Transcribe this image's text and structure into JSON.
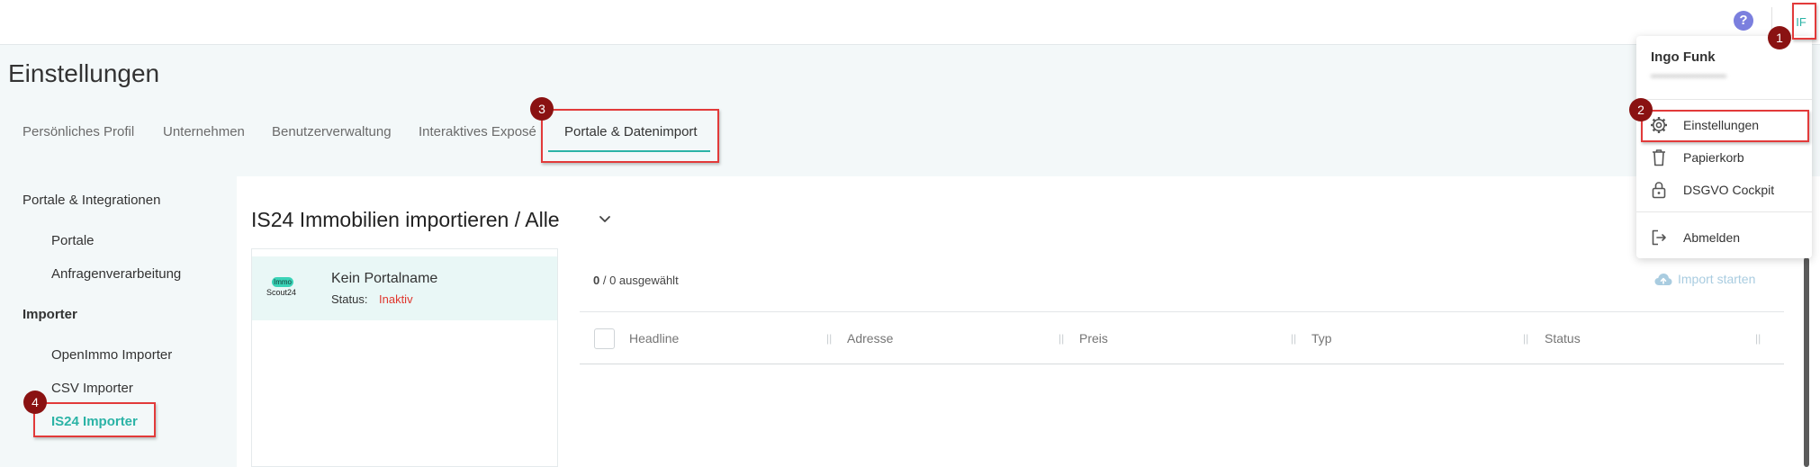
{
  "topbar": {
    "help_icon": "question-circle-icon",
    "avatar_initials": "IF"
  },
  "page": {
    "title": "Einstellungen"
  },
  "tabs": [
    {
      "label": "Persönliches Profil"
    },
    {
      "label": "Unternehmen"
    },
    {
      "label": "Benutzerverwaltung"
    },
    {
      "label": "Interaktives Exposé"
    },
    {
      "label": "Portale & Datenimport",
      "active": true
    }
  ],
  "sidebar": {
    "section1": {
      "heading": "Portale & Integrationen",
      "items": [
        {
          "label": "Portale"
        },
        {
          "label": "Anfragenverarbeitung"
        }
      ]
    },
    "section2": {
      "heading": "Importer",
      "items": [
        {
          "label": "OpenImmo Importer"
        },
        {
          "label": "CSV Importer"
        },
        {
          "label": "IS24 Importer",
          "active": true
        }
      ]
    }
  },
  "main": {
    "title": "IS24 Immobilien importieren / Alle",
    "portal": {
      "logo_pill": "Immo",
      "logo_text": "Scout24",
      "name": "Kein Portalname",
      "status_label": "Status:",
      "status_value": "Inaktiv"
    },
    "selection": {
      "count": "0",
      "rest": " / 0 ausgewählt"
    },
    "import_button": "Import starten",
    "columns": [
      "Headline",
      "Adresse",
      "Preis",
      "Typ",
      "Status"
    ]
  },
  "user_menu": {
    "name": "Ingo Funk",
    "items": [
      {
        "label": "Einstellungen",
        "icon": "gear-icon"
      },
      {
        "label": "Papierkorb",
        "icon": "trash-icon"
      },
      {
        "label": "DSGVO Cockpit",
        "icon": "lock-icon"
      },
      {
        "label": "Abmelden",
        "icon": "logout-icon"
      }
    ]
  },
  "annotations": {
    "badges": [
      "1",
      "2",
      "3",
      "4"
    ],
    "highlight_color": "#e23a3a",
    "badge_color": "#8a1212"
  },
  "colors": {
    "accent": "#2bb3a6",
    "inactive": "#e0362d",
    "help": "#7b7fde"
  }
}
